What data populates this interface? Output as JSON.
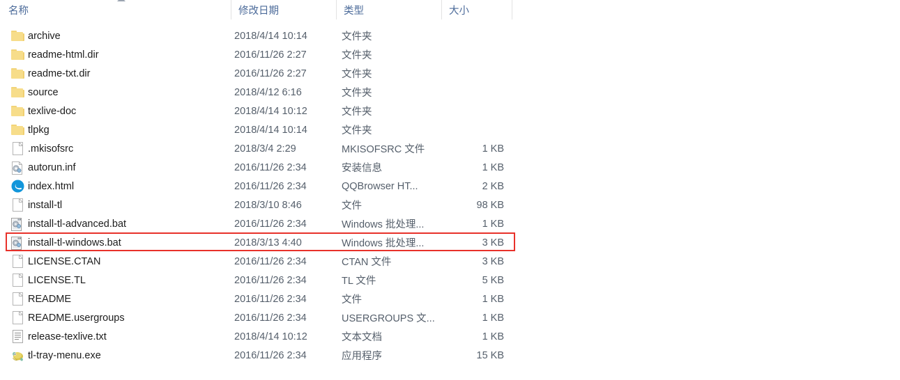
{
  "header": {
    "columns": [
      {
        "label": "名称",
        "key": "name"
      },
      {
        "label": "修改日期",
        "key": "date"
      },
      {
        "label": "类型",
        "key": "type"
      },
      {
        "label": "大小",
        "key": "size"
      }
    ],
    "sort_column": "名称",
    "sort_direction": "ascending",
    "text_color": "#4c6b9a",
    "divider_color": "#e2e2e2"
  },
  "highlight": {
    "color": "#e8312a",
    "target_row_name": "install-tl-windows.bat"
  },
  "rows": [
    {
      "icon": "folder",
      "name": "archive",
      "date": "2018/4/14 10:14",
      "type": "文件夹",
      "size": "",
      "highlighted": false
    },
    {
      "icon": "folder",
      "name": "readme-html.dir",
      "date": "2016/11/26 2:27",
      "type": "文件夹",
      "size": "",
      "highlighted": false
    },
    {
      "icon": "folder",
      "name": "readme-txt.dir",
      "date": "2016/11/26 2:27",
      "type": "文件夹",
      "size": "",
      "highlighted": false
    },
    {
      "icon": "folder",
      "name": "source",
      "date": "2018/4/12 6:16",
      "type": "文件夹",
      "size": "",
      "highlighted": false
    },
    {
      "icon": "folder",
      "name": "texlive-doc",
      "date": "2018/4/14 10:12",
      "type": "文件夹",
      "size": "",
      "highlighted": false
    },
    {
      "icon": "folder",
      "name": "tlpkg",
      "date": "2018/4/14 10:14",
      "type": "文件夹",
      "size": "",
      "highlighted": false
    },
    {
      "icon": "doc",
      "name": ".mkisofsrc",
      "date": "2018/3/4 2:29",
      "type": "MKISOFSRC 文件",
      "size": "1 KB",
      "highlighted": false
    },
    {
      "icon": "gearpage",
      "name": "autorun.inf",
      "date": "2016/11/26 2:34",
      "type": "安装信息",
      "size": "1 KB",
      "highlighted": false
    },
    {
      "icon": "browser",
      "name": "index.html",
      "date": "2016/11/26 2:34",
      "type": "QQBrowser HT...",
      "size": "2 KB",
      "highlighted": false
    },
    {
      "icon": "doc",
      "name": "install-tl",
      "date": "2018/3/10 8:46",
      "type": "文件",
      "size": "98 KB",
      "highlighted": false
    },
    {
      "icon": "bat",
      "name": "install-tl-advanced.bat",
      "date": "2016/11/26 2:34",
      "type": "Windows 批处理...",
      "size": "1 KB",
      "highlighted": false
    },
    {
      "icon": "bat",
      "name": "install-tl-windows.bat",
      "date": "2018/3/13 4:40",
      "type": "Windows 批处理...",
      "size": "3 KB",
      "highlighted": true
    },
    {
      "icon": "doc",
      "name": "LICENSE.CTAN",
      "date": "2016/11/26 2:34",
      "type": "CTAN 文件",
      "size": "3 KB",
      "highlighted": false
    },
    {
      "icon": "doc",
      "name": "LICENSE.TL",
      "date": "2016/11/26 2:34",
      "type": "TL 文件",
      "size": "5 KB",
      "highlighted": false
    },
    {
      "icon": "doc",
      "name": "README",
      "date": "2016/11/26 2:34",
      "type": "文件",
      "size": "1 KB",
      "highlighted": false
    },
    {
      "icon": "doc",
      "name": "README.usergroups",
      "date": "2016/11/26 2:34",
      "type": "USERGROUPS 文...",
      "size": "1 KB",
      "highlighted": false
    },
    {
      "icon": "txt",
      "name": "release-texlive.txt",
      "date": "2018/4/14 10:12",
      "type": "文本文档",
      "size": "1 KB",
      "highlighted": false
    },
    {
      "icon": "exe",
      "name": "tl-tray-menu.exe",
      "date": "2016/11/26 2:34",
      "type": "应用程序",
      "size": "15 KB",
      "highlighted": false
    }
  ]
}
